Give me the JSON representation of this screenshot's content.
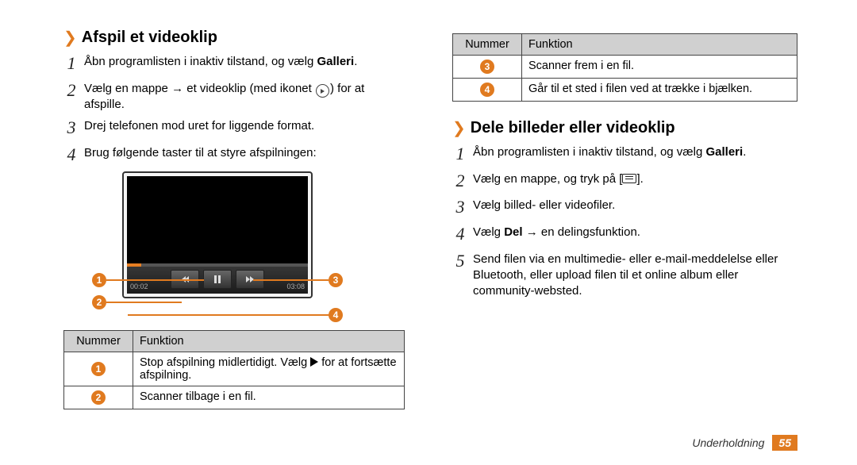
{
  "left": {
    "heading": "Afspil et videoklip",
    "steps": {
      "s1a": "Åbn programlisten i inaktiv tilstand, og vælg ",
      "s1b": "Galleri",
      "s1c": ".",
      "s2a": "Vælg en mappe → et videoklip (med ikonet ",
      "s2b": ") for at afspille.",
      "s3": "Drej telefonen mod uret for liggende format.",
      "s4": "Brug følgende taster til at styre afspilningen:"
    },
    "player": {
      "callouts": {
        "c1": "1",
        "c2": "2",
        "c3": "3",
        "c4": "4"
      },
      "ctime": "00:02",
      "dtime": "03:08"
    },
    "table": {
      "h1": "Nummer",
      "h2": "Funktion",
      "r1key": "1",
      "r1a": "Stop afspilning midlertidigt. Vælg ",
      "r1b": " for at fortsætte afspilning.",
      "r2key": "2",
      "r2": "Scanner tilbage i en fil."
    }
  },
  "right": {
    "table": {
      "h1": "Nummer",
      "h2": "Funktion",
      "r3key": "3",
      "r3": "Scanner frem i en fil.",
      "r4key": "4",
      "r4": "Går til et sted i filen ved at trække i bjælken."
    },
    "heading": "Dele billeder eller videoklip",
    "steps": {
      "s1a": "Åbn programlisten i inaktiv tilstand, og vælg ",
      "s1b": "Galleri",
      "s1c": ".",
      "s2a": "Vælg en mappe, og tryk på [",
      "s2b": "].",
      "s3": "Vælg billed- eller videofiler.",
      "s4a": "Vælg ",
      "s4b": "Del",
      "s4c": " → en delingsfunktion.",
      "s5": "Send filen via en multimedie- eller e-mail-meddelelse eller Bluetooth, eller upload filen til et online album eller community-websted."
    }
  },
  "footer": {
    "section": "Underholdning",
    "page": "55"
  }
}
